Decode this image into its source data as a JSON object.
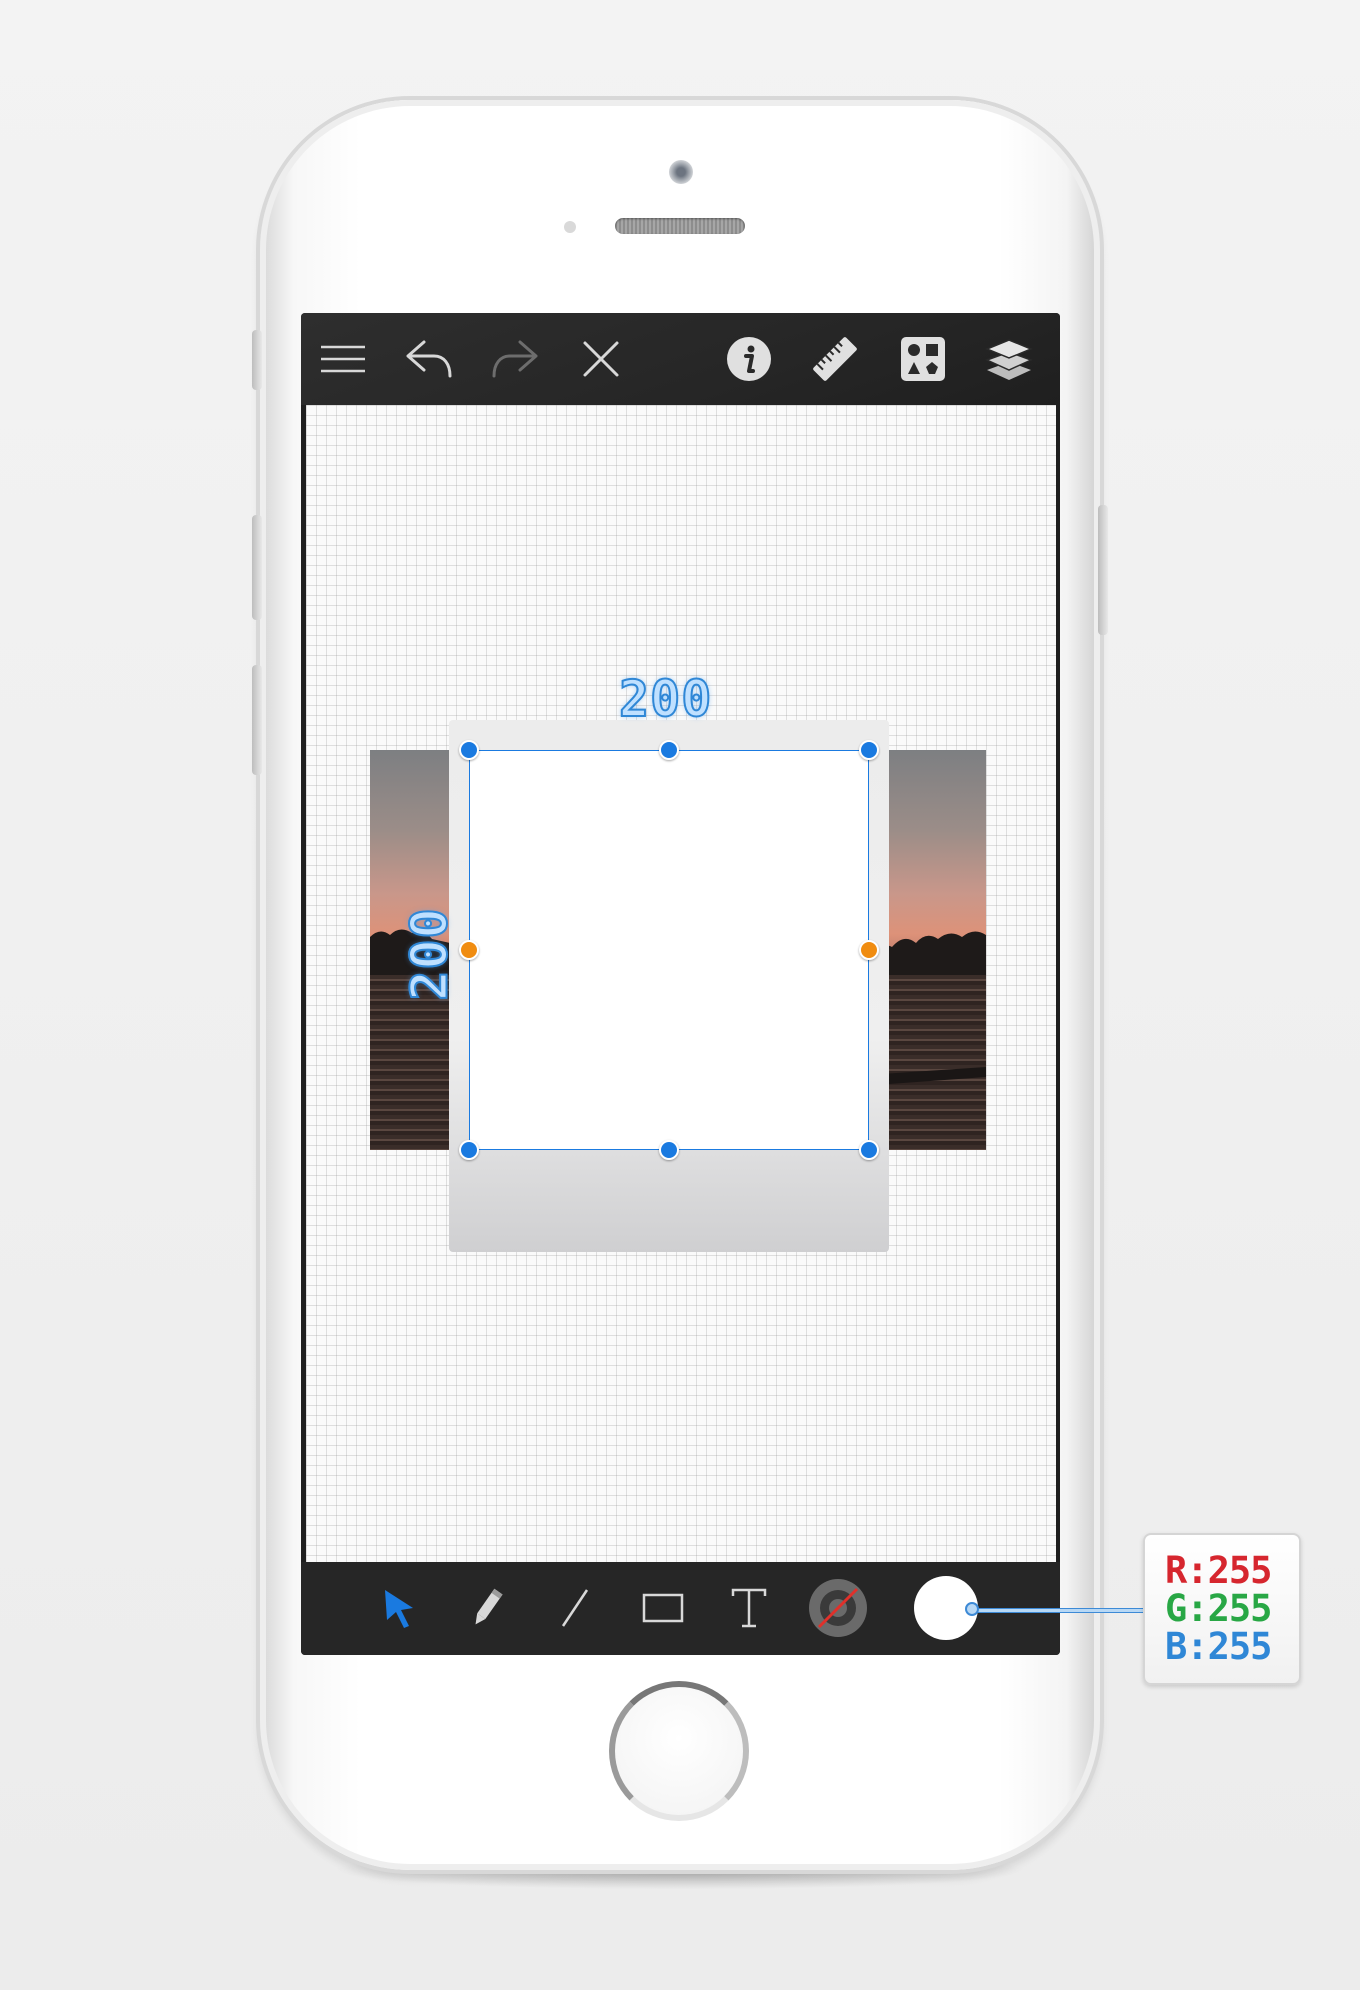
{
  "phone": {
    "model": "iPhone"
  },
  "toolbar_top": {
    "items": [
      {
        "name": "menu-icon"
      },
      {
        "name": "undo-icon"
      },
      {
        "name": "redo-icon"
      },
      {
        "name": "close-icon"
      },
      {
        "name": "info-icon"
      },
      {
        "name": "ruler-icon"
      },
      {
        "name": "shapes-library-icon"
      },
      {
        "name": "layers-icon"
      }
    ]
  },
  "canvas": {
    "selection": {
      "width_label": "200",
      "height_label": "200",
      "fill_color": "#ffffff",
      "stroke_color": "#1a7ae0"
    }
  },
  "toolbar_bottom": {
    "items": [
      {
        "name": "select-arrow-icon",
        "active": true
      },
      {
        "name": "pencil-icon"
      },
      {
        "name": "line-icon"
      },
      {
        "name": "rectangle-icon"
      },
      {
        "name": "text-icon"
      },
      {
        "name": "stroke-color-none-icon"
      },
      {
        "name": "fill-color-swatch"
      }
    ]
  },
  "color_callout": {
    "r_label": "R:",
    "r_value": "255",
    "g_label": "G:",
    "g_value": "255",
    "b_label": "B:",
    "b_value": "255",
    "r_color": "#d6262e",
    "g_color": "#28a745",
    "b_color": "#2f87d6"
  },
  "colors": {
    "accent_blue": "#1a7ae0",
    "handle_orange": "#f08c10",
    "toolbar_dark": "#262626"
  }
}
